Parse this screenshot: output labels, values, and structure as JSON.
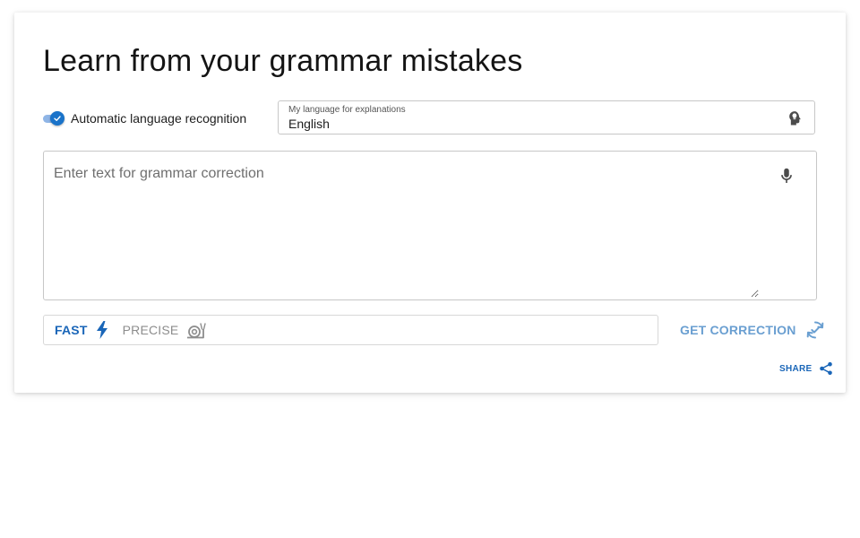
{
  "header": {
    "title": "Learn from your grammar mistakes"
  },
  "toggle": {
    "label": "Automatic language recognition",
    "checked": true
  },
  "language_select": {
    "caption": "My language for explanations",
    "value": "English",
    "icon": "head-lightbulb-icon"
  },
  "editor": {
    "placeholder": "Enter text for grammar correction",
    "value": "",
    "mic_icon": "microphone-icon"
  },
  "modes": {
    "fast_label": "FAST",
    "fast_icon": "lightning-icon",
    "precise_label": "PRECISE",
    "precise_icon": "snail-icon",
    "selected": "FAST"
  },
  "actions": {
    "get_correction_label": "GET CORRECTION",
    "get_correction_icon": "sync-check-icon",
    "share_label": "SHARE",
    "share_icon": "share-icon"
  },
  "colors": {
    "accent": "#1a66b8",
    "accent_light": "#6a9fd1",
    "toggle_track": "#8fb5e6",
    "muted": "#8d8d8d",
    "border": "#c7c7c7"
  }
}
